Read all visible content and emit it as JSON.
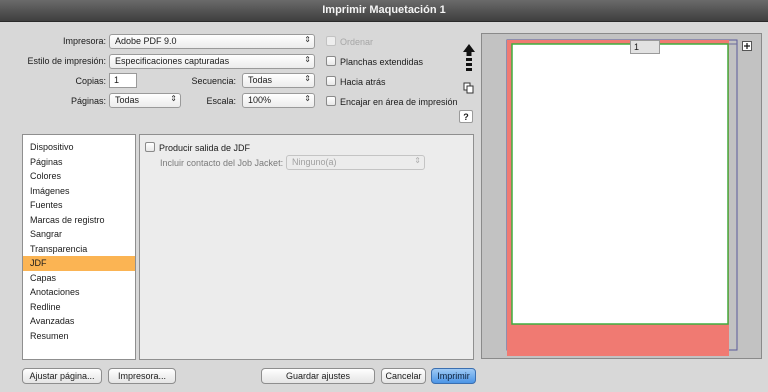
{
  "window": {
    "title": "Imprimir Maquetación 1"
  },
  "top": {
    "printer_label": "Impresora:",
    "printer_value": "Adobe PDF 9.0",
    "style_label": "Estilo de impresión:",
    "style_value": "Especificaciones capturadas",
    "copies_label": "Copias:",
    "copies_value": "1",
    "pages_label": "Páginas:",
    "pages_value": "Todas",
    "sequence_label": "Secuencia:",
    "sequence_value": "Todas",
    "scale_label": "Escala:",
    "scale_value": "100%",
    "ordenar": "Ordenar",
    "planchas": "Planchas extendidas",
    "hacia_atras": "Hacia atrás",
    "encajar": "Encajar en área de impresión",
    "help": "?"
  },
  "sidebar": {
    "items": [
      {
        "label": "Dispositivo"
      },
      {
        "label": "Páginas"
      },
      {
        "label": "Colores"
      },
      {
        "label": "Imágenes"
      },
      {
        "label": "Fuentes"
      },
      {
        "label": "Marcas de registro"
      },
      {
        "label": "Sangrar"
      },
      {
        "label": "Transparencia"
      },
      {
        "label": "JDF"
      },
      {
        "label": "Capas"
      },
      {
        "label": "Anotaciones"
      },
      {
        "label": "Redline"
      },
      {
        "label": "Avanzadas"
      },
      {
        "label": "Resumen"
      }
    ],
    "selected_index": 8
  },
  "jdf": {
    "produce_label": "Producir salida de JDF",
    "contact_label": "Incluir contacto del Job Jacket:",
    "contact_value": "Ninguno(a)"
  },
  "preview": {
    "page_number": "1"
  },
  "buttons": {
    "ajustar": "Ajustar página...",
    "impresora": "Impresora...",
    "guardar": "Guardar ajustes",
    "cancelar": "Cancelar",
    "imprimir": "Imprimir"
  },
  "colors": {
    "selected_row": "#fbb453",
    "bleed_red": "#f07a72",
    "margin_green": "#3fae3f",
    "default_button": "#4c95e6"
  }
}
